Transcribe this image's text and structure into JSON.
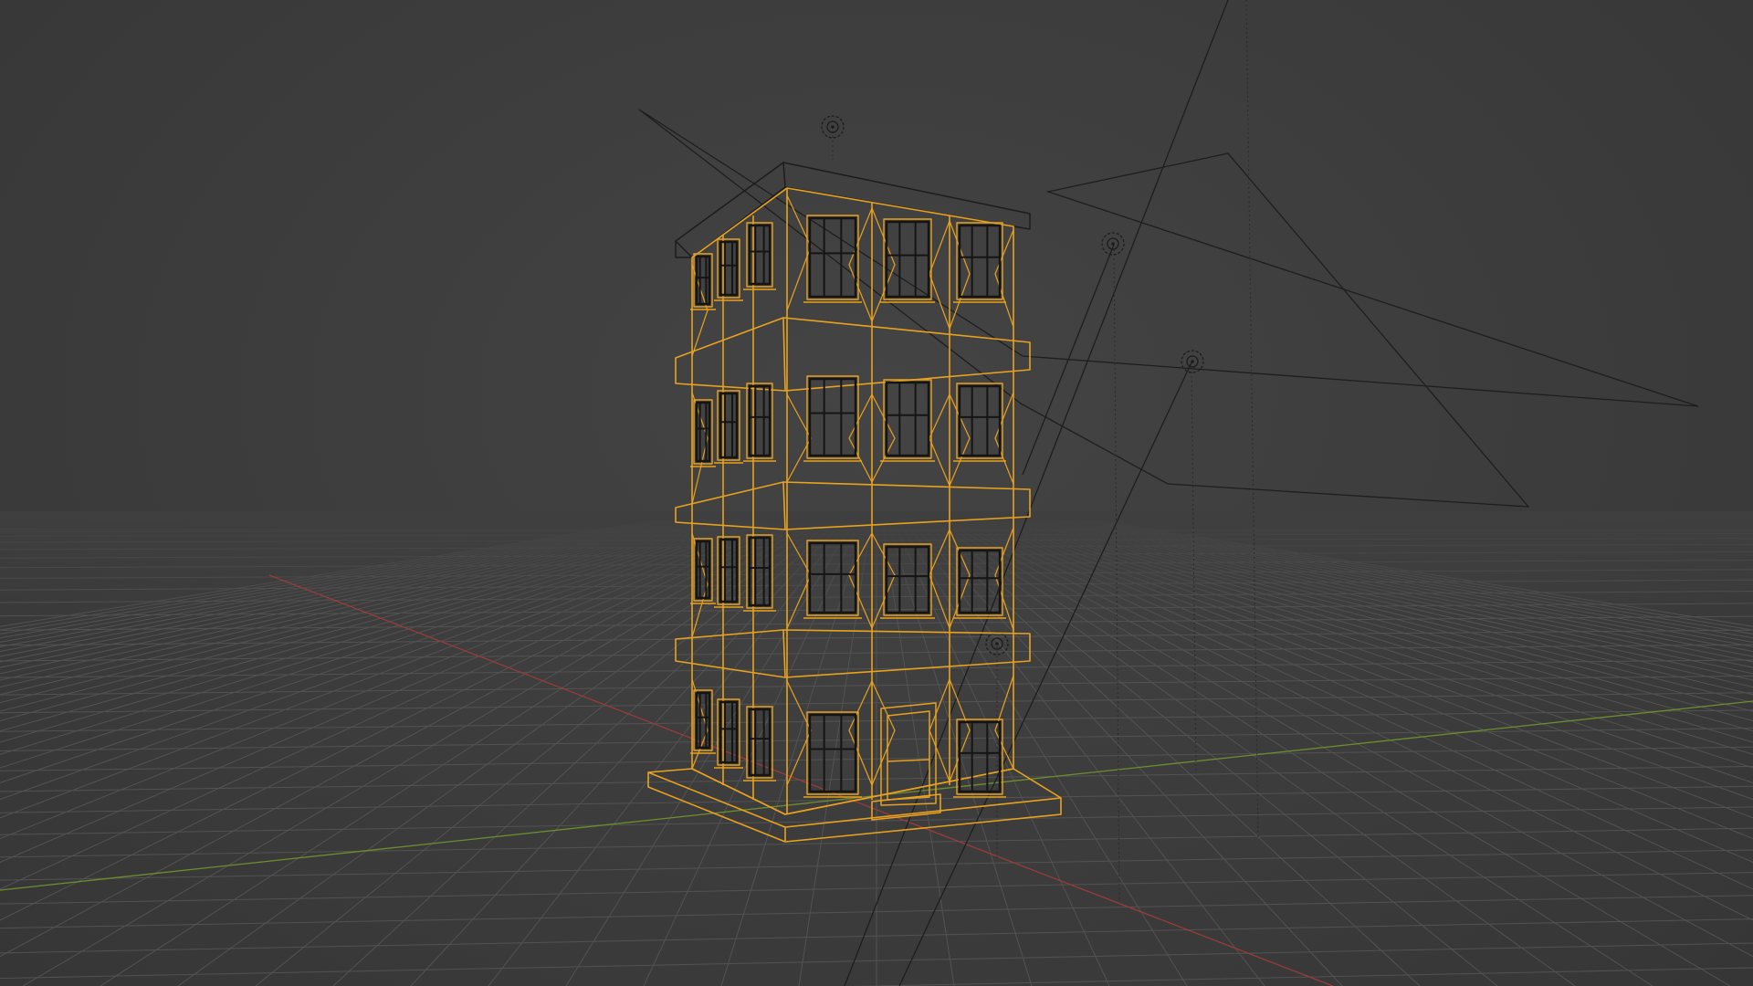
{
  "viewport": {
    "shading_mode": "wireframe",
    "selected_object": "building",
    "colors": {
      "background": "#3d3d3d",
      "grid": "#525252",
      "x_axis": "#9a3b3b",
      "y_axis": "#6b8f2e",
      "selection": "#e8a21f",
      "wire_dark": "#1c1c1c",
      "helper_line": "#202020"
    },
    "icons": [
      "light-icon",
      "light-icon",
      "light-icon",
      "light-icon"
    ]
  }
}
